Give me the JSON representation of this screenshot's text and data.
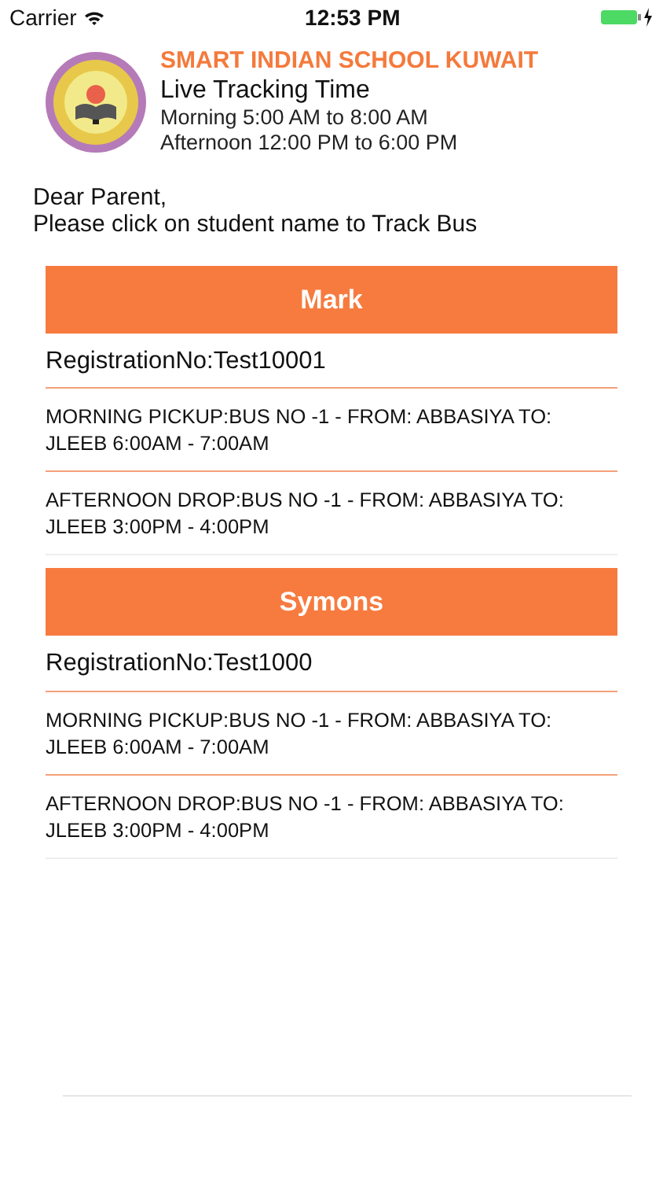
{
  "status_bar": {
    "carrier": "Carrier",
    "time": "12:53 PM"
  },
  "header": {
    "school": "SMART INDIAN SCHOOL KUWAIT",
    "title": "Live Tracking Time",
    "times": [
      "Morning 5:00 AM to 8:00 AM",
      "Afternoon 12:00 PM to 6:00 PM"
    ]
  },
  "greeting": [
    "Dear Parent,",
    "Please click on student name to Track Bus"
  ],
  "students": [
    {
      "name": "Mark",
      "registration": "RegistrationNo:Test10001",
      "routes": [
        "MORNING PICKUP:BUS NO -1 - FROM: ABBASIYA TO: JLEEB 6:00AM - 7:00AM",
        "AFTERNOON DROP:BUS NO -1 - FROM: ABBASIYA TO: JLEEB 3:00PM - 4:00PM"
      ]
    },
    {
      "name": "Symons",
      "registration": "RegistrationNo:Test1000",
      "routes": [
        "MORNING PICKUP:BUS NO -1 - FROM: ABBASIYA TO: JLEEB 6:00AM - 7:00AM",
        "AFTERNOON DROP:BUS NO -1 - FROM: ABBASIYA TO: JLEEB 3:00PM - 4:00PM"
      ]
    }
  ]
}
